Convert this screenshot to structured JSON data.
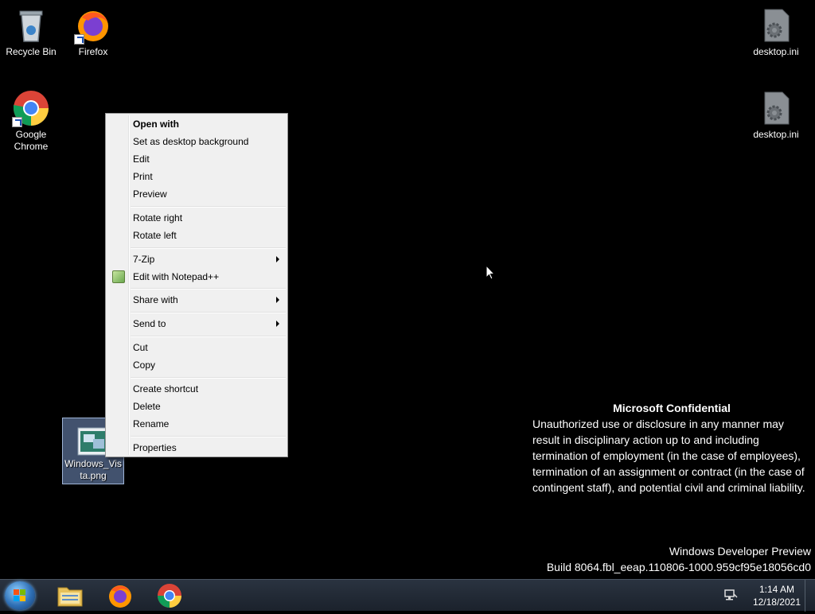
{
  "desktop": {
    "icons": [
      {
        "label": "Recycle Bin"
      },
      {
        "label": "Firefox"
      },
      {
        "label": "Google Chrome"
      },
      {
        "label": "desktop.ini"
      },
      {
        "label": "desktop.ini"
      },
      {
        "label": "Windows_Vista.png"
      }
    ]
  },
  "context_menu": {
    "items": [
      {
        "label": "Open with",
        "bold": true
      },
      {
        "label": "Set as desktop background"
      },
      {
        "label": "Edit"
      },
      {
        "label": "Print"
      },
      {
        "label": "Preview"
      },
      {
        "label": "Rotate right"
      },
      {
        "label": "Rotate left"
      },
      {
        "label": "7-Zip",
        "submenu": true
      },
      {
        "label": "Edit with Notepad++",
        "icon": "notepad-plus-plus-icon"
      },
      {
        "label": "Share with",
        "submenu": true
      },
      {
        "label": "Send to",
        "submenu": true
      },
      {
        "label": "Cut"
      },
      {
        "label": "Copy"
      },
      {
        "label": "Create shortcut"
      },
      {
        "label": "Delete"
      },
      {
        "label": "Rename"
      },
      {
        "label": "Properties"
      }
    ]
  },
  "watermark": {
    "title": "Microsoft Confidential",
    "body": "Unauthorized use or disclosure in any manner may result in disciplinary action up to and including termination of employment (in the case of employees), termination of an assignment or contract (in the case of contingent staff), and potential civil and criminal liability.",
    "edition": "Windows Developer Preview",
    "build": "Build 8064.fbl_eeap.110806-1000.959cf95e18056cd0"
  },
  "taskbar": {
    "pinned": [
      {
        "icon": "file-explorer-icon"
      },
      {
        "icon": "firefox-icon"
      },
      {
        "icon": "chrome-icon"
      }
    ],
    "clock": {
      "time": "1:14 AM",
      "date": "12/18/2021"
    }
  }
}
